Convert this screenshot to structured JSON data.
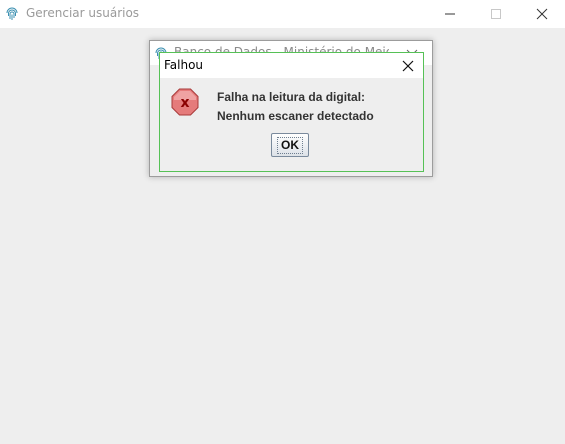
{
  "main_window": {
    "title": "Gerenciar usuários",
    "icon": "fingerprint-icon"
  },
  "parent_dialog": {
    "title": "Banco de Dados - Ministério do Meio A...",
    "icon": "fingerprint-icon"
  },
  "error_dialog": {
    "title": "Falhou",
    "icon": "error-x-icon",
    "message_line_1": "Falha na leitura da digital:",
    "message_line_2": "Nenhum escaner detectado",
    "ok_label": "OK"
  },
  "colors": {
    "focus_border": "#56c156",
    "error_icon_fill": "#e57b7b",
    "error_icon_mark": "#8b0000"
  }
}
